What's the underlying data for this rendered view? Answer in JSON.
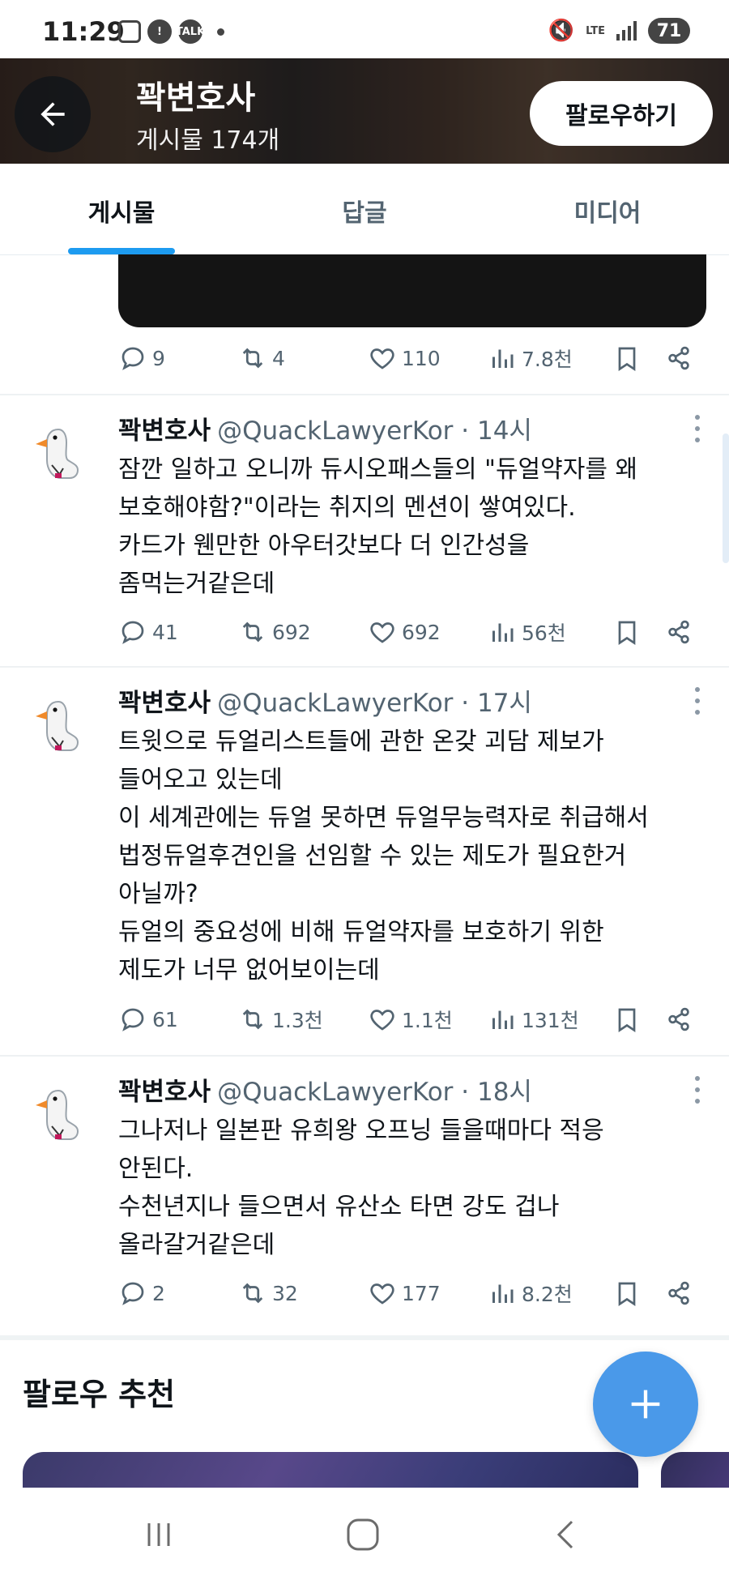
{
  "status_bar": {
    "time": "11:29",
    "network": "LTE",
    "battery": "71"
  },
  "header": {
    "title": "꽉변호사",
    "post_count": "게시물 174개",
    "follow_label": "팔로우하기"
  },
  "tabs": [
    {
      "label": "게시물",
      "active": true
    },
    {
      "label": "답글",
      "active": false
    },
    {
      "label": "미디어",
      "active": false
    }
  ],
  "prev_tweet_stats": {
    "replies": "9",
    "retweets": "4",
    "likes": "110",
    "views": "7.8천"
  },
  "tweets": [
    {
      "name": "꽉변호사",
      "handle": "@QuackLawyerKor",
      "time": "· 14시",
      "lines": [
        "잠깐 일하고 오니까 듀시오패스들의 \"듀얼약자를 왜",
        "보호해야함?\"이라는 취지의 멘션이 쌓여있다.",
        "카드가 웬만한 아우터갓보다 더 인간성을",
        "좀먹는거같은데"
      ],
      "stats": {
        "replies": "41",
        "retweets": "692",
        "likes": "692",
        "views": "56천"
      }
    },
    {
      "name": "꽉변호사",
      "handle": "@QuackLawyerKor",
      "time": "· 17시",
      "lines": [
        "트윗으로 듀얼리스트들에 관한 온갖 괴담 제보가",
        "들어오고 있는데",
        "이 세계관에는 듀얼 못하면 듀얼무능력자로 취급해서",
        "법정듀얼후견인을 선임할 수 있는 제도가 필요한거",
        "아닐까?",
        "듀얼의 중요성에 비해 듀얼약자를 보호하기 위한",
        "제도가 너무 없어보이는데"
      ],
      "stats": {
        "replies": "61",
        "retweets": "1.3천",
        "likes": "1.1천",
        "views": "131천"
      }
    },
    {
      "name": "꽉변호사",
      "handle": "@QuackLawyerKor",
      "time": "· 18시",
      "lines": [
        "그나저나 일본판 유희왕 오프닝 들을때마다 적응",
        "안된다.",
        "수천년지나 들으면서 유산소 타면 강도 겁나",
        "올라갈거같은데"
      ],
      "stats": {
        "replies": "2",
        "retweets": "32",
        "likes": "177",
        "views": "8.2천"
      }
    }
  ],
  "who_to_follow": {
    "title": "팔로우 추천"
  },
  "colors": {
    "accent": "#1d9bf0",
    "fab": "#4a99e9",
    "muted": "#536471"
  }
}
